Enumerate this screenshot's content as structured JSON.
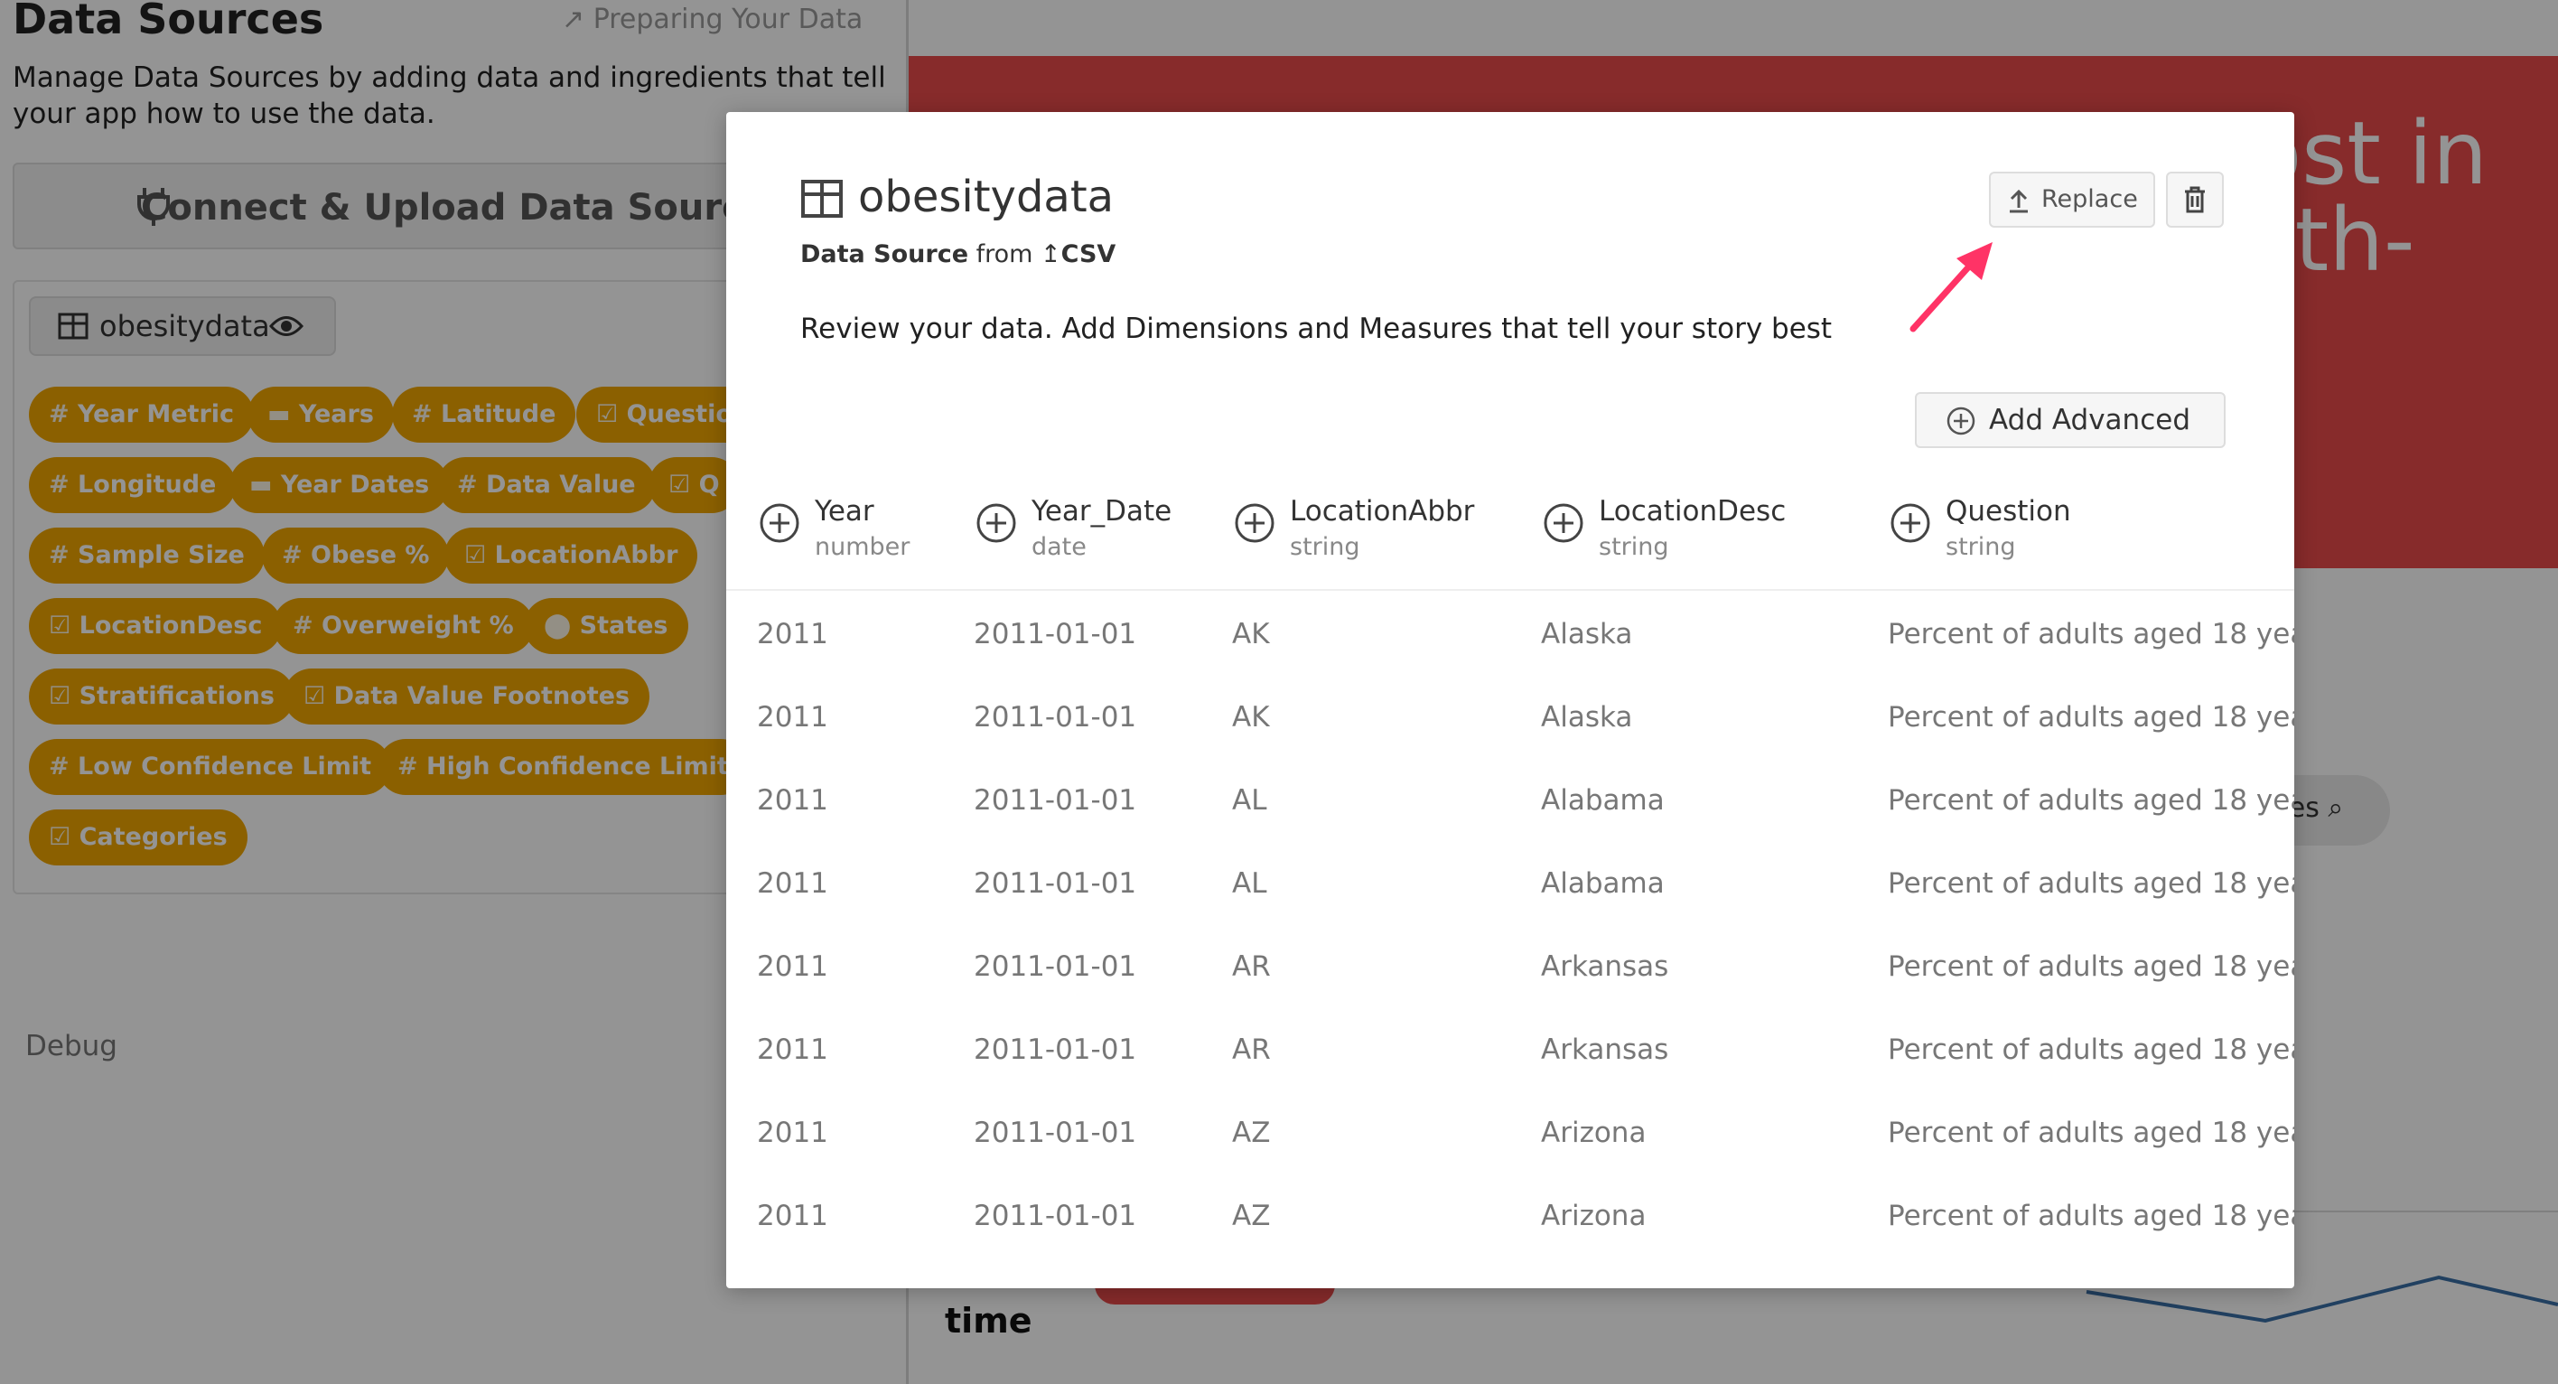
{
  "sidebar": {
    "title": "Data Sources",
    "preparing_link": "Preparing Your Data",
    "description": "Manage Data Sources by adding data and ingredients that tell your app how to use the data.",
    "connect_button": "Connect & Upload Data Source",
    "source_name": "obesitydata",
    "debug": "Debug",
    "pills": [
      {
        "icon": "#",
        "label": "Year Metric"
      },
      {
        "icon": "▬",
        "label": "Years"
      },
      {
        "icon": "#",
        "label": "Latitude"
      },
      {
        "icon": "☑",
        "label": "Question"
      },
      {
        "icon": "#",
        "label": "Longitude"
      },
      {
        "icon": "▬",
        "label": "Year Dates"
      },
      {
        "icon": "#",
        "label": "Data Value"
      },
      {
        "icon": "☑",
        "label": "Q"
      },
      {
        "icon": "#",
        "label": "Sample Size"
      },
      {
        "icon": "#",
        "label": "Obese %"
      },
      {
        "icon": "☑",
        "label": "LocationAbbr"
      },
      {
        "icon": "☑",
        "label": "LocationDesc"
      },
      {
        "icon": "#",
        "label": "Overweight %"
      },
      {
        "icon": "⬤",
        "label": "States"
      },
      {
        "icon": "☑",
        "label": "Stratifications"
      },
      {
        "icon": "☑",
        "label": "Data Value Footnotes"
      },
      {
        "icon": "#",
        "label": "Low Confidence Limit"
      },
      {
        "icon": "#",
        "label": "High Confidence Limit"
      },
      {
        "icon": "☑",
        "label": "Categories"
      }
    ]
  },
  "background": {
    "hero_text": "most in\nealth-\nts?",
    "hero_color": "#e94a4a",
    "search_fragment": "tes",
    "timeline_label": "time"
  },
  "modal": {
    "title": "obesitydata",
    "subtitle_bold": "Data Source",
    "subtitle_from": "from",
    "subtitle_type": "CSV",
    "replace_label": "Replace",
    "description": "Review your data. Add Dimensions and Measures that tell your story best",
    "add_advanced_label": "Add Advanced",
    "columns": [
      {
        "name": "Year",
        "type": "number"
      },
      {
        "name": "Year_Date",
        "type": "date"
      },
      {
        "name": "LocationAbbr",
        "type": "string"
      },
      {
        "name": "LocationDesc",
        "type": "string"
      },
      {
        "name": "Question",
        "type": "string"
      }
    ],
    "rows": [
      [
        "2011",
        "2011-01-01",
        "AK",
        "Alaska",
        "Percent of adults aged 18 yea"
      ],
      [
        "2011",
        "2011-01-01",
        "AK",
        "Alaska",
        "Percent of adults aged 18 yea"
      ],
      [
        "2011",
        "2011-01-01",
        "AL",
        "Alabama",
        "Percent of adults aged 18 yea"
      ],
      [
        "2011",
        "2011-01-01",
        "AL",
        "Alabama",
        "Percent of adults aged 18 yea"
      ],
      [
        "2011",
        "2011-01-01",
        "AR",
        "Arkansas",
        "Percent of adults aged 18 yea"
      ],
      [
        "2011",
        "2011-01-01",
        "AR",
        "Arkansas",
        "Percent of adults aged 18 yea"
      ],
      [
        "2011",
        "2011-01-01",
        "AZ",
        "Arizona",
        "Percent of adults aged 18 yea"
      ],
      [
        "2011",
        "2011-01-01",
        "AZ",
        "Arizona",
        "Percent of adults aged 18 yea"
      ]
    ]
  },
  "colors": {
    "pill": "#f0a500",
    "annotation_arrow": "#ff3366"
  }
}
